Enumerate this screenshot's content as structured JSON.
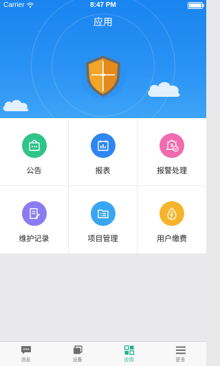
{
  "status_bar": {
    "carrier": "Carrier",
    "time": "8:47 PM"
  },
  "header": {
    "title": "应用"
  },
  "apps": [
    {
      "label": "公告",
      "icon": "announcement-icon",
      "color": "#2ec48a"
    },
    {
      "label": "报表",
      "icon": "report-icon",
      "color": "#2f86f0"
    },
    {
      "label": "报警处理",
      "icon": "alarm-icon",
      "color": "#f06bb0"
    },
    {
      "label": "维护记录",
      "icon": "maintenance-log-icon",
      "color": "#8a7cf0"
    },
    {
      "label": "项目管理",
      "icon": "project-folder-icon",
      "color": "#3aa6f2"
    },
    {
      "label": "用户缴费",
      "icon": "payment-drop-icon",
      "color": "#f5b42a"
    }
  ],
  "tabbar": {
    "items": [
      {
        "label": "消息",
        "icon": "message-icon",
        "active": false
      },
      {
        "label": "设备",
        "icon": "device-icon",
        "active": false
      },
      {
        "label": "应用",
        "icon": "apps-grid-icon",
        "active": true
      },
      {
        "label": "更多",
        "icon": "menu-icon",
        "active": false
      }
    ],
    "active_color": "#1fb38a",
    "inactive_color": "#7a7a7a"
  }
}
